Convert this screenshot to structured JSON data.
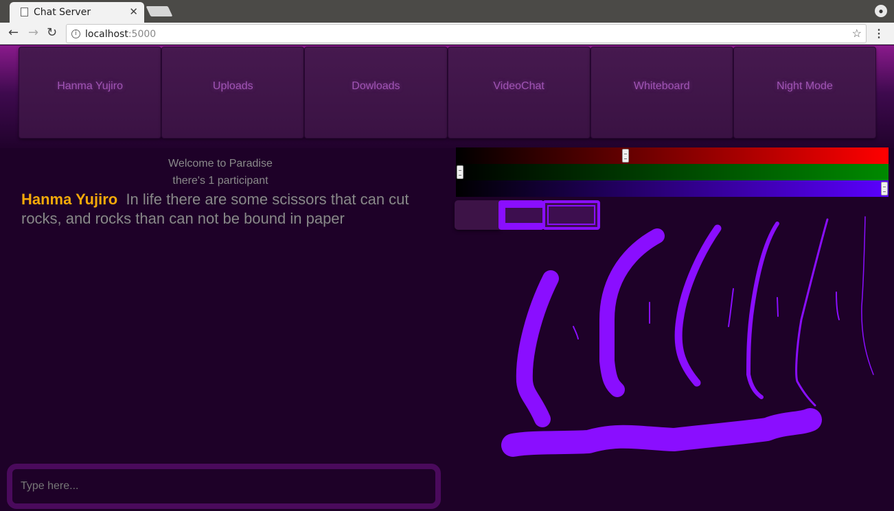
{
  "browser": {
    "tab_title": "Chat Server",
    "close_glyph": "✕",
    "url_host": "localhost",
    "url_port": ":5000",
    "back_glyph": "←",
    "forward_glyph": "→",
    "reload_glyph": "↻",
    "star_glyph": "☆",
    "menu_glyph": "⋮",
    "info_glyph": "i",
    "profile_glyph": "●"
  },
  "navbar": {
    "items": [
      {
        "label": "Hanma Yujiro"
      },
      {
        "label": "Uploads"
      },
      {
        "label": "Dowloads"
      },
      {
        "label": "VideoChat"
      },
      {
        "label": "Whiteboard"
      },
      {
        "label": "Night Mode"
      }
    ]
  },
  "chat": {
    "welcome": "Welcome to Paradise",
    "participants": "there's 1 participant",
    "messages": [
      {
        "author": "Hanma Yujiro",
        "text": "In life there are some scissors that can cut rocks, and rocks than can not be bound in paper"
      }
    ],
    "input_placeholder": "Type here..."
  },
  "whiteboard": {
    "color_sliders": {
      "red": 0.39,
      "green": 0.0,
      "blue": 1.0
    },
    "stroke_color": "#8a0eff",
    "brush_sizes": [
      "small",
      "medium",
      "large"
    ]
  }
}
